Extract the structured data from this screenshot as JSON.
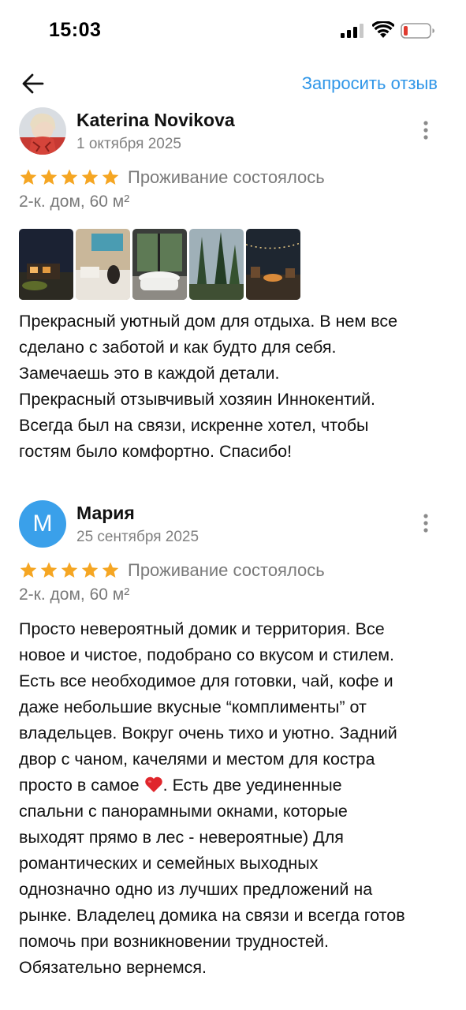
{
  "status_bar": {
    "time": "15:03"
  },
  "nav": {
    "back_icon": "arrow-left-icon",
    "request_review_label": "Запросить отзыв",
    "accent_color": "#2f96e8"
  },
  "reviews": [
    {
      "author": "Katerina Novikova",
      "date": "1 октября 2025",
      "avatar": "photo",
      "rating": 5,
      "stay_status": "Проживание состоялось",
      "property": "2-к. дом, 60 м²",
      "photos_count": 5,
      "text": "Прекрасный уютный дом для отдыха. В нем все\nсделано с заботой и как будто для себя.\nЗамечаешь это в каждой детали.\nПрекрасный отзывчивый хозяин Иннокентий.\nВсегда был на связи, искренне хотел, чтобы\nгостям было комфортно. Спасибо!"
    },
    {
      "author": "Мария",
      "avatar_letter": "М",
      "date": "25 сентября 2025",
      "rating": 5,
      "stay_status": "Проживание состоялось",
      "property": "2-к. дом, 60 м²",
      "text_before_emoji": "Просто невероятный домик и территория. Все\nновое и чистое, подобрано со вкусом и стилем.\nЕсть все необходимое для готовки, чай, кофе и\nдаже небольшие вкусные “комплименты” от\nвладельцев. Вокруг очень тихо и уютно. Задний\nдвор с чаном, качелями и местом для костра\nпросто в самое ",
      "emoji": "heart-icon",
      "text_after_emoji": ". Есть две уединенные\nспальни с панорамными окнами, которые\nвыходят прямо в лес - невероятные) Для\nромантических и семейных выходных\nоднозначно одно из лучших предложений на\nрынке. Владелец домика на связи и всегда готов\nпомочь при возникновении трудностей.\nОбязательно вернемся."
    }
  ],
  "colors": {
    "star": "#f5a623",
    "secondary_text": "#7a7a7a",
    "avatar_letter_bg": "#3aa0ea"
  }
}
